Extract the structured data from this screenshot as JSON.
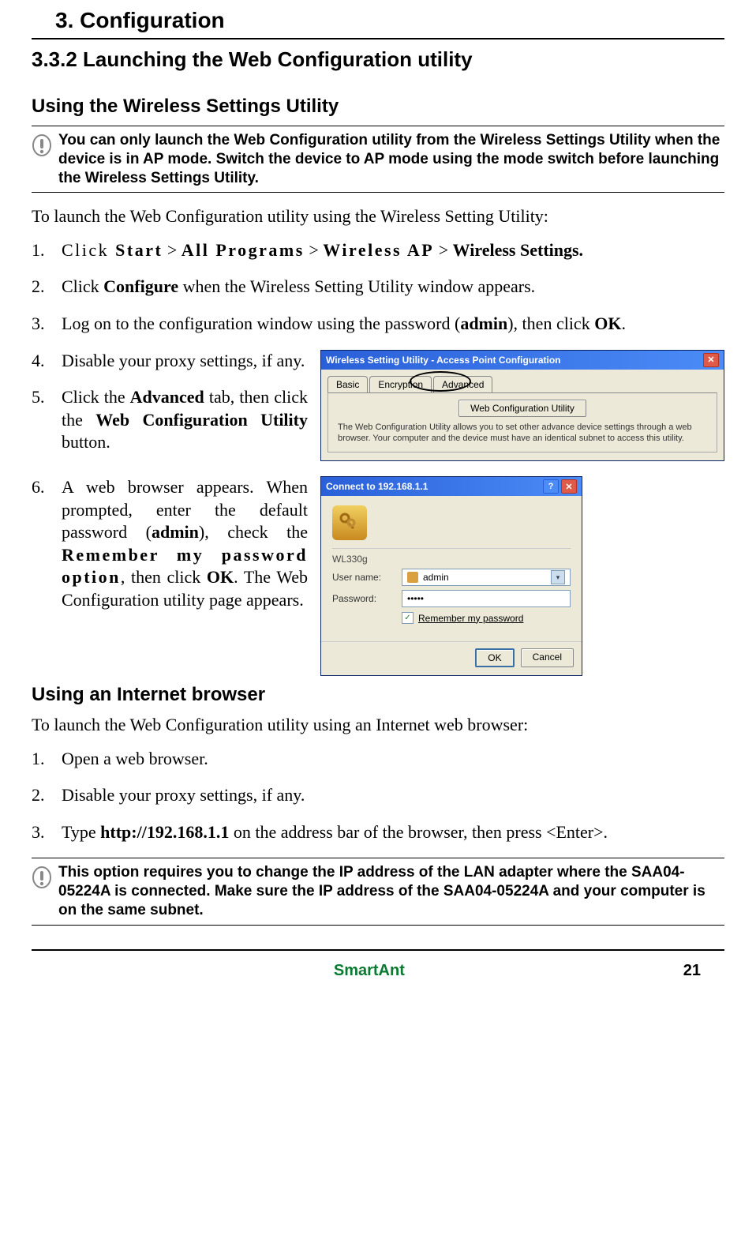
{
  "chapter_title": "3. Configuration",
  "section_title": "3.3.2    Launching the Web Configuration utility",
  "subhead1": "Using the Wireless Settings Utility",
  "note1": "You can only launch the Web Configuration utility from the Wireless Settings Utility when the device is in AP mode. Switch the device to AP mode using the mode switch before launching the Wireless Settings Utility.",
  "intro1": "To launch the Web Configuration utility using the Wireless Setting Utility:",
  "steps1": {
    "s1_pre": "Click ",
    "s1_start": "Start",
    "s1_gt1": " > ",
    "s1_all": "All Programs",
    "s1_gt2": " >  ",
    "s1_ap": "Wireless AP",
    "s1_gt3": " > ",
    "s1_ws": "Wireless Settings.",
    "s2_a": "Click ",
    "s2_b": "Configure",
    "s2_c": " when the Wireless Setting Utility window appears.",
    "s3_a": "Log on to the configuration window using the password (",
    "s3_b": "admin",
    "s3_c": "), then click ",
    "s3_d": "OK",
    "s3_e": ".",
    "s4": "Disable your proxy settings, if any.",
    "s5_a": "Click the ",
    "s5_b": "Advanced",
    "s5_c": " tab, then click the ",
    "s5_d": "Web Configuration Utility",
    "s5_e": " button.",
    "s6_a": "A web browser appears. When prompted, enter the default password (",
    "s6_b": "admin",
    "s6_c": "), check the ",
    "s6_d": "Remember my password option",
    "s6_e": ", then click ",
    "s6_f": "OK",
    "s6_g": ". The Web Configuration utility page appears."
  },
  "win1": {
    "title": "Wireless Setting Utility - Access Point Configuration",
    "tabs": {
      "basic": "Basic",
      "enc": "Encryption",
      "adv": "Advanced"
    },
    "button": "Web Configuration Utility",
    "hint": "The Web Configuration Utility allows you to set other advance device settings through a web browser. Your computer and the device must have an identical subnet to access this utility."
  },
  "win2": {
    "title": "Connect to 192.168.1.1",
    "section": "WL330g",
    "user_label": "User name:",
    "user_value": "admin",
    "pass_label": "Password:",
    "pass_value": "•••••",
    "remember": "Remember my password",
    "ok": "OK",
    "cancel": "Cancel"
  },
  "subhead2": "Using an Internet browser",
  "intro2": "To launch the Web Configuration utility using an Internet web browser:",
  "steps2": {
    "s1": "Open a web browser.",
    "s2": "Disable your proxy settings, if any.",
    "s3_a": "Type ",
    "s3_b": "http://192.168.1.1",
    "s3_c": " on the address bar of the browser, then press <Enter>."
  },
  "note2": "This option requires you to change the IP address of the LAN adapter where the SAA04-05224A is connected. Make sure the IP address of the SAA04-05224A and your computer is on the same subnet.",
  "footer": {
    "brand": "SmartAnt",
    "page": "21"
  }
}
